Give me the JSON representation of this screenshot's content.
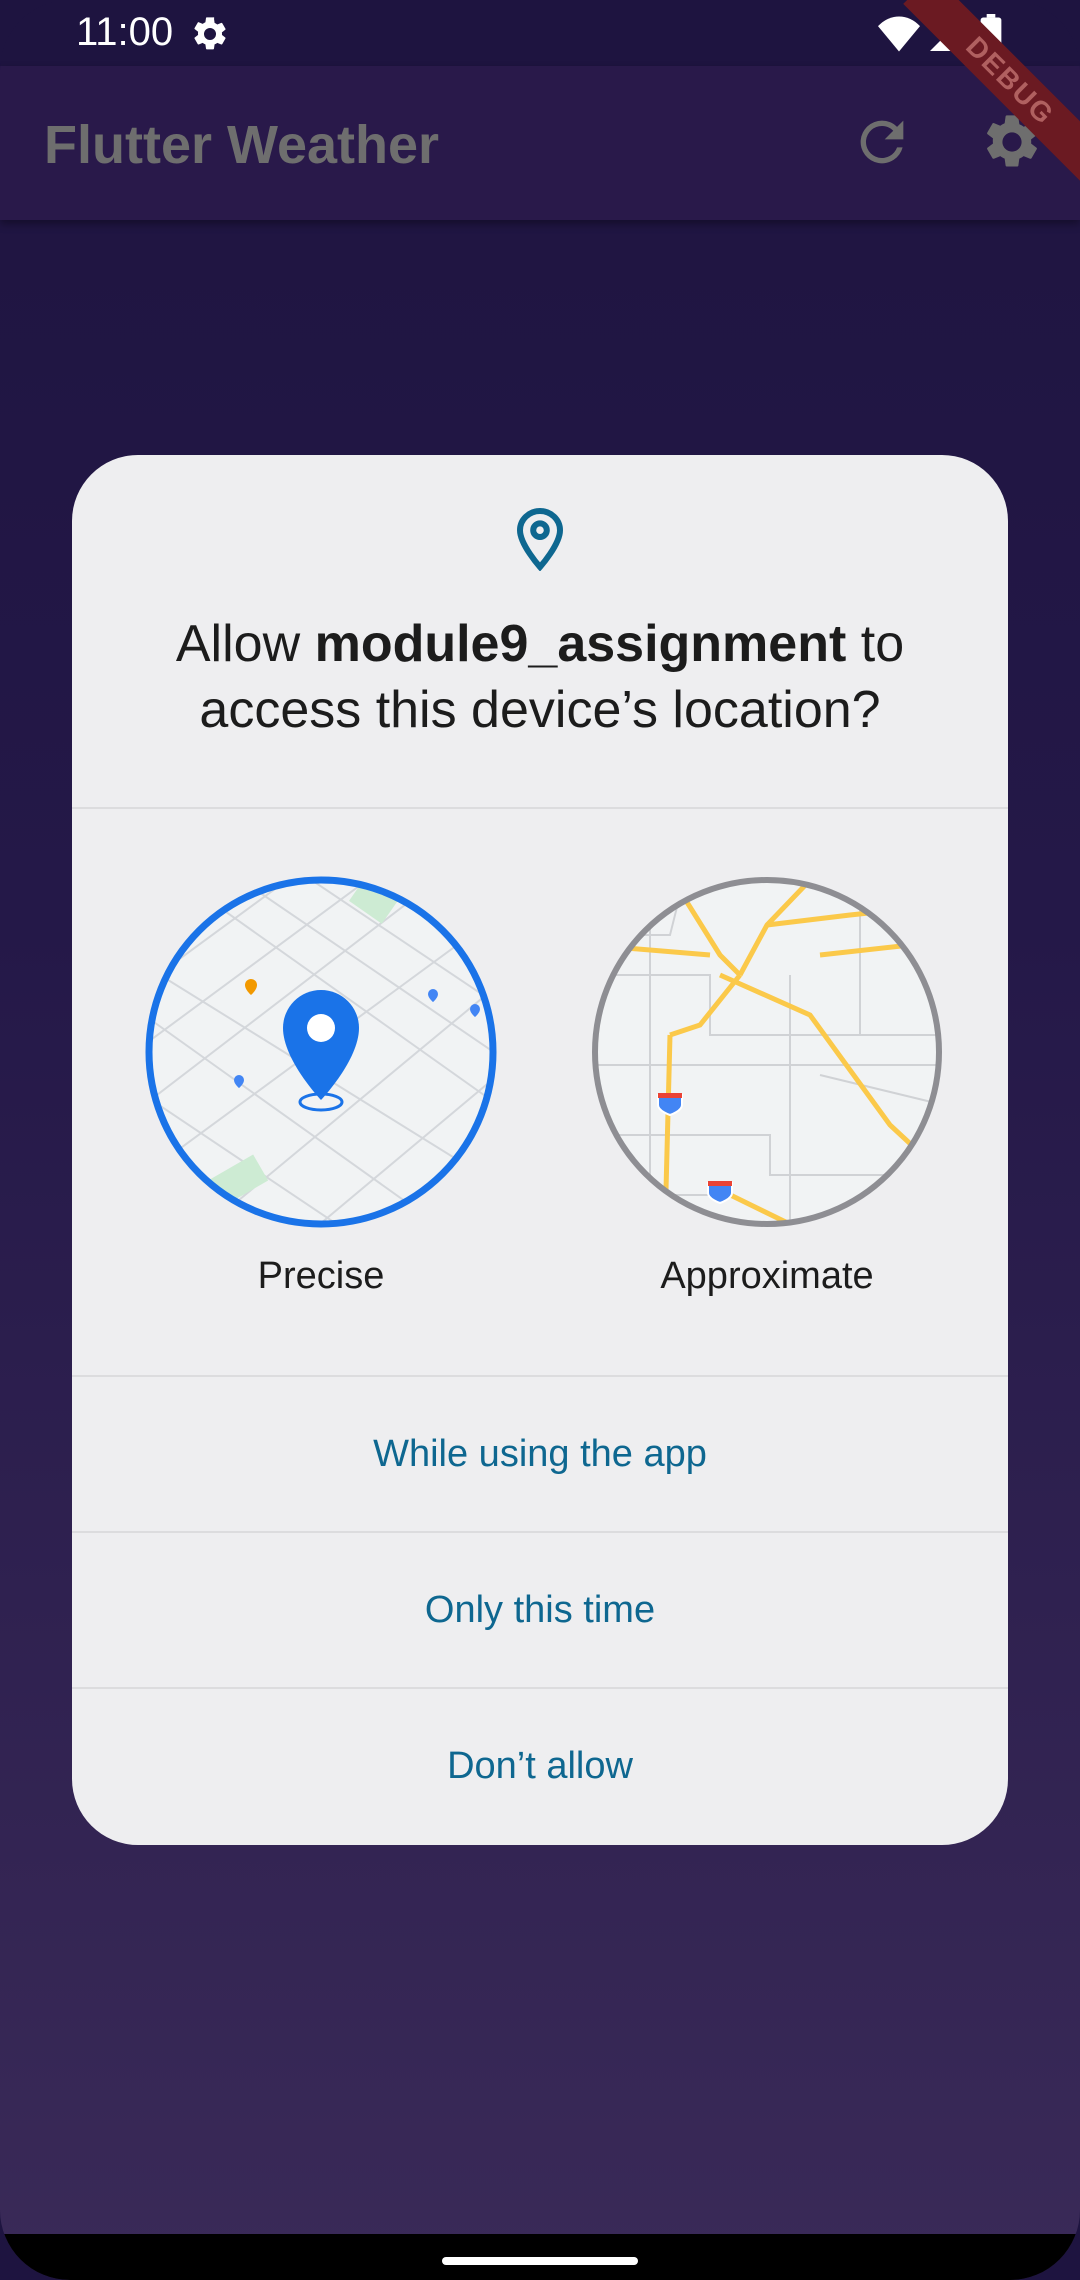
{
  "status_bar": {
    "time": "11:00",
    "icons": [
      "settings-icon",
      "wifi-icon",
      "signal-icon",
      "battery-icon"
    ]
  },
  "app_bar": {
    "title": "Flutter Weather",
    "actions": [
      "refresh-icon",
      "settings-icon"
    ]
  },
  "debug_banner": "DEBUG",
  "dialog": {
    "icon": "location-pin-icon",
    "title_prefix": "Allow ",
    "app_name": "module9_assignment",
    "title_suffix": " to access this device’s location?",
    "options": [
      {
        "label": "Precise",
        "selected": true
      },
      {
        "label": "Approximate",
        "selected": false
      }
    ],
    "buttons": [
      "While using the app",
      "Only this time",
      "Don’t allow"
    ]
  },
  "colors": {
    "background": "#1e1440",
    "app_bar": "#29194a",
    "dialog": "#eeeef0",
    "accent_text": "#0e6790",
    "precise_ring": "#1a73e8",
    "approximate_ring": "#8e8e93"
  }
}
